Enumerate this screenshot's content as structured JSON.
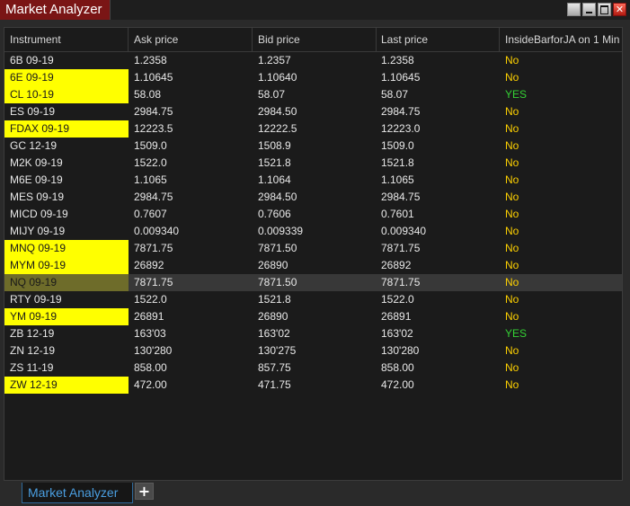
{
  "window": {
    "title": "Market Analyzer",
    "buttons": {
      "restore": "",
      "minimize": "",
      "maximize": "",
      "close": "✕"
    }
  },
  "table": {
    "columns": [
      "Instrument",
      "Ask price",
      "Bid price",
      "Last price",
      "InsideBarforJA on 1 Min"
    ],
    "rows": [
      {
        "instrument": "6B 09-19",
        "ask": "1.2358",
        "bid": "1.2357",
        "last": "1.2358",
        "signal": "No",
        "highlight": false
      },
      {
        "instrument": "6E 09-19",
        "ask": "1.10645",
        "bid": "1.10640",
        "last": "1.10645",
        "signal": "No",
        "highlight": true
      },
      {
        "instrument": "CL 10-19",
        "ask": "58.08",
        "bid": "58.07",
        "last": "58.07",
        "signal": "YES",
        "highlight": true
      },
      {
        "instrument": "ES 09-19",
        "ask": "2984.75",
        "bid": "2984.50",
        "last": "2984.75",
        "signal": "No",
        "highlight": false
      },
      {
        "instrument": "FDAX 09-19",
        "ask": "12223.5",
        "bid": "12222.5",
        "last": "12223.0",
        "signal": "No",
        "highlight": true
      },
      {
        "instrument": "GC 12-19",
        "ask": "1509.0",
        "bid": "1508.9",
        "last": "1509.0",
        "signal": "No",
        "highlight": false
      },
      {
        "instrument": "M2K 09-19",
        "ask": "1522.0",
        "bid": "1521.8",
        "last": "1521.8",
        "signal": "No",
        "highlight": false
      },
      {
        "instrument": "M6E 09-19",
        "ask": "1.1065",
        "bid": "1.1064",
        "last": "1.1065",
        "signal": "No",
        "highlight": false
      },
      {
        "instrument": "MES 09-19",
        "ask": "2984.75",
        "bid": "2984.50",
        "last": "2984.75",
        "signal": "No",
        "highlight": false
      },
      {
        "instrument": "MICD 09-19",
        "ask": "0.7607",
        "bid": "0.7606",
        "last": "0.7601",
        "signal": "No",
        "highlight": false
      },
      {
        "instrument": "MIJY 09-19",
        "ask": "0.009340",
        "bid": "0.009339",
        "last": "0.009340",
        "signal": "No",
        "highlight": false
      },
      {
        "instrument": "MNQ 09-19",
        "ask": "7871.75",
        "bid": "7871.50",
        "last": "7871.75",
        "signal": "No",
        "highlight": true
      },
      {
        "instrument": "MYM 09-19",
        "ask": "26892",
        "bid": "26890",
        "last": "26892",
        "signal": "No",
        "highlight": true
      },
      {
        "instrument": "NQ 09-19",
        "ask": "7871.75",
        "bid": "7871.50",
        "last": "7871.75",
        "signal": "No",
        "highlight": true,
        "selected": true
      },
      {
        "instrument": "RTY 09-19",
        "ask": "1522.0",
        "bid": "1521.8",
        "last": "1522.0",
        "signal": "No",
        "highlight": false
      },
      {
        "instrument": "YM 09-19",
        "ask": "26891",
        "bid": "26890",
        "last": "26891",
        "signal": "No",
        "highlight": true
      },
      {
        "instrument": "ZB 12-19",
        "ask": "163'03",
        "bid": "163'02",
        "last": "163'02",
        "signal": "YES",
        "highlight": false
      },
      {
        "instrument": "ZN 12-19",
        "ask": "130'280",
        "bid": "130'275",
        "last": "130'280",
        "signal": "No",
        "highlight": false
      },
      {
        "instrument": "ZS 11-19",
        "ask": "858.00",
        "bid": "857.75",
        "last": "858.00",
        "signal": "No",
        "highlight": false
      },
      {
        "instrument": "ZW 12-19",
        "ask": "472.00",
        "bid": "471.75",
        "last": "472.00",
        "signal": "No",
        "highlight": true
      }
    ]
  },
  "tabs": {
    "items": [
      {
        "label": "Market Analyzer",
        "active": true
      }
    ],
    "add_label": "+"
  },
  "colors": {
    "highlight": "#ffff00",
    "signal_no": "#ffd200",
    "signal_yes": "#34d034",
    "title_tab": "#7a1515",
    "tab_text": "#4a9ee0"
  }
}
